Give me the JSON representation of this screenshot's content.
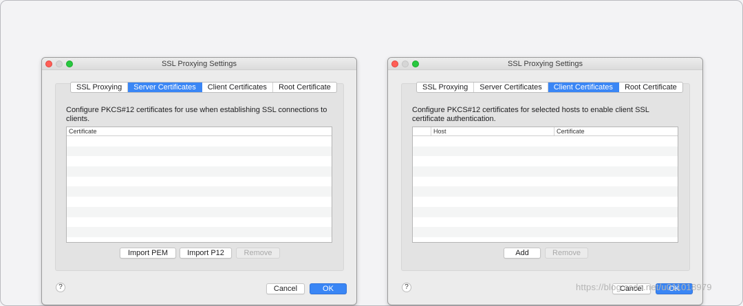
{
  "left_window": {
    "title": "SSL Proxying Settings",
    "tabs": [
      {
        "label": "SSL Proxying",
        "active": false
      },
      {
        "label": "Server Certificates",
        "active": true
      },
      {
        "label": "Client Certificates",
        "active": false
      },
      {
        "label": "Root Certificate",
        "active": false
      }
    ],
    "description": "Configure PKCS#12 certificates for use when establishing SSL connections to clients.",
    "table": {
      "columns": [
        "Certificate"
      ],
      "rows": []
    },
    "buttons": {
      "import_pem": "Import PEM",
      "import_p12": "Import P12",
      "remove": "Remove"
    },
    "help": "?",
    "cancel": "Cancel",
    "ok": "OK"
  },
  "right_window": {
    "title": "SSL Proxying Settings",
    "tabs": [
      {
        "label": "SSL Proxying",
        "active": false
      },
      {
        "label": "Server Certificates",
        "active": false
      },
      {
        "label": "Client Certificates",
        "active": true
      },
      {
        "label": "Root Certificate",
        "active": false
      }
    ],
    "description": "Configure PKCS#12 certificates for selected hosts to enable client SSL certificate authentication.",
    "table": {
      "columns": [
        "",
        "Host",
        "Certificate"
      ],
      "rows": []
    },
    "buttons": {
      "add": "Add",
      "remove": "Remove"
    },
    "help": "?",
    "cancel": "Cancel",
    "ok": "OK"
  },
  "watermark": "https://blog.csdn.net/u011018979",
  "colors": {
    "accent": "#3a86f5",
    "close": "#ff5f57",
    "zoom": "#28c840"
  }
}
